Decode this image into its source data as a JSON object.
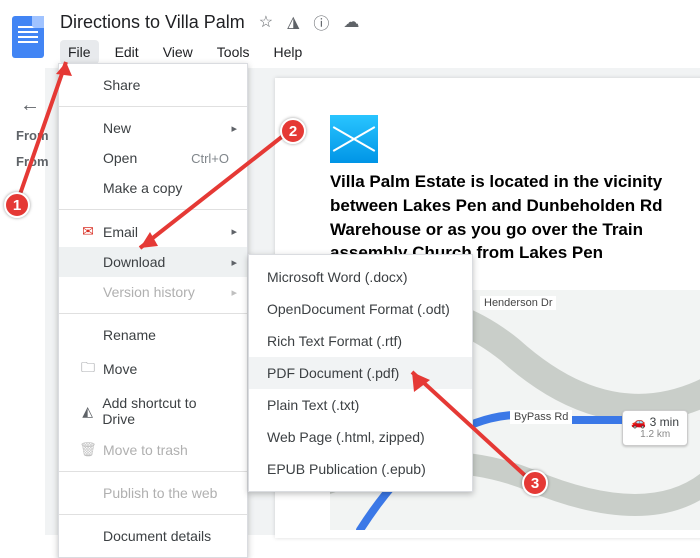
{
  "header": {
    "title": "Directions to Villa Palm"
  },
  "menubar": {
    "file": "File",
    "edit": "Edit",
    "view": "View",
    "tools": "Tools",
    "help": "Help"
  },
  "outline": {
    "line1": "From",
    "line2": "From"
  },
  "fileMenu": {
    "share": "Share",
    "new": "New",
    "open": "Open",
    "open_shortcut": "Ctrl+O",
    "make_copy": "Make a copy",
    "email": "Email",
    "download": "Download",
    "version_history": "Version history",
    "rename": "Rename",
    "move": "Move",
    "add_shortcut": "Add shortcut to Drive",
    "move_to_trash": "Move to trash",
    "publish": "Publish to the web",
    "document_details": "Document details"
  },
  "downloadMenu": {
    "docx": "Microsoft Word (.docx)",
    "odt": "OpenDocument Format (.odt)",
    "rtf": "Rich Text Format (.rtf)",
    "pdf": "PDF Document (.pdf)",
    "txt": "Plain Text (.txt)",
    "html": "Web Page (.html, zipped)",
    "epub": "EPUB Publication (.epub)"
  },
  "document": {
    "paragraph": "Villa Palm Estate is located in the vicinity between Lakes Pen and Dunbeholden Rd Warehouse or as you go over the Train assembly Church from Lakes Pen"
  },
  "map": {
    "road1": "Henderson Dr",
    "road2": "ByPass Rd",
    "duration": "3 min",
    "distance": "1.2 km"
  },
  "annotations": {
    "step1": "1",
    "step2": "2",
    "step3": "3"
  }
}
